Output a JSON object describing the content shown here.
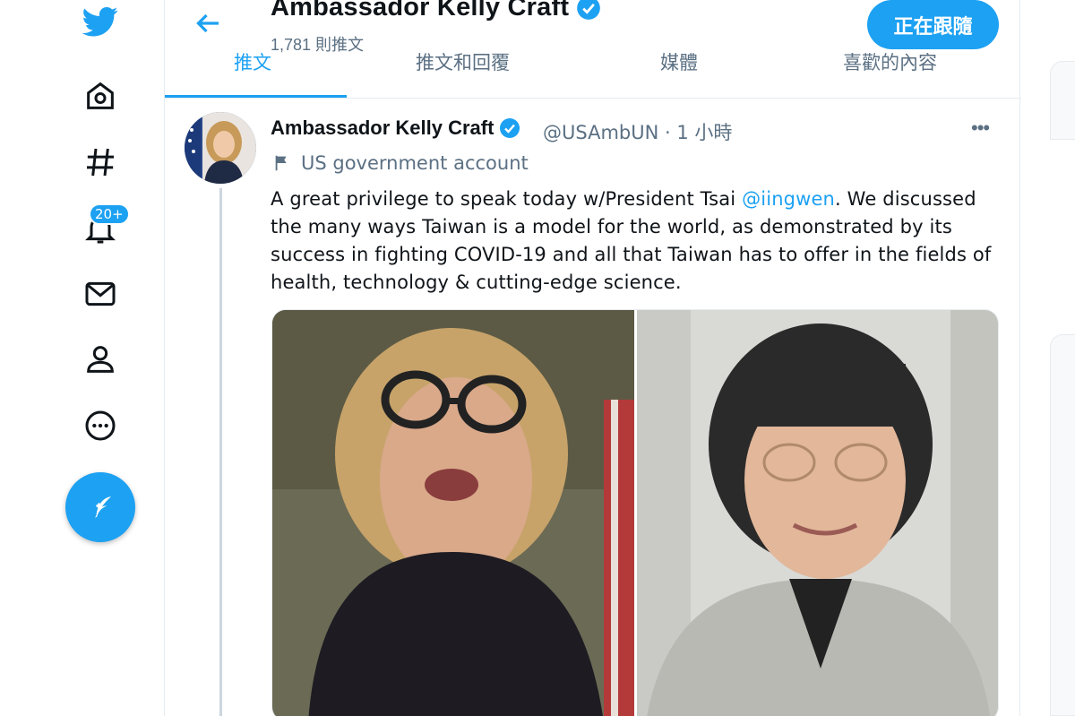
{
  "header": {
    "title": "Ambassador Kelly Craft",
    "tweet_count": "1,781 則推文",
    "follow_label": "正在跟隨"
  },
  "tabs": [
    {
      "label": "推文"
    },
    {
      "label": "推文和回覆"
    },
    {
      "label": "媒體"
    },
    {
      "label": "喜歡的內容"
    }
  ],
  "nav": {
    "notifications_badge": "20+"
  },
  "tweet": {
    "author_name": "Ambassador Kelly Craft",
    "handle_time": "@USAmbUN · 1 小時",
    "more": "•••",
    "account_label": "US government account",
    "text_before": "A great privilege to speak today w/President Tsai ",
    "mention": "@iingwen",
    "text_after": ". We discussed the many ways Taiwan is a model for the world, as demonstrated by its success in fighting COVID-19 and all that Taiwan has to offer in the fields of health, technology & cutting-edge science."
  },
  "colors": {
    "accent": "#1da1f2",
    "secondary_text": "#5b7083",
    "border": "#e6ecf0"
  }
}
